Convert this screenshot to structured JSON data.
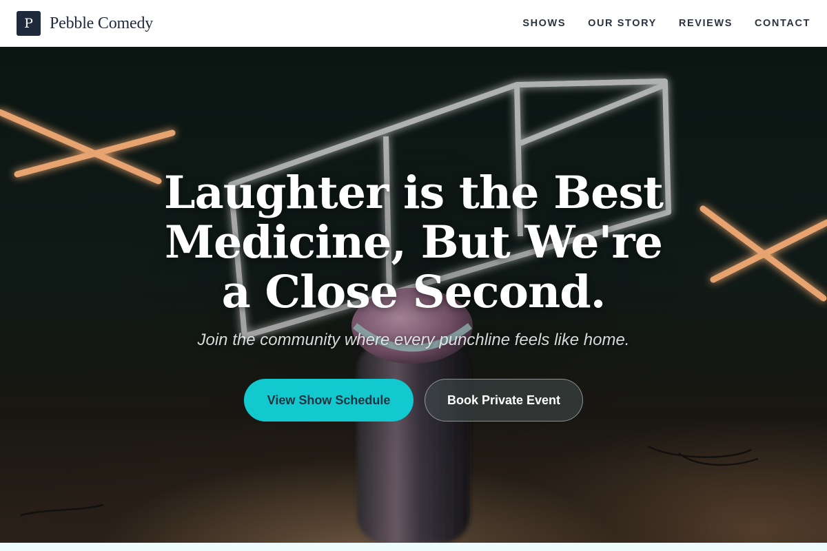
{
  "nav": {
    "logo_letter": "P",
    "brand_name": "Pebble Comedy",
    "links": [
      "SHOWS",
      "OUR STORY",
      "REVIEWS",
      "CONTACT"
    ]
  },
  "hero": {
    "title": "Laughter is the Best Medicine, But We're a Close Second.",
    "subtitle": "Join the community where every punchline feels like home.",
    "primary_button": "View Show Schedule",
    "secondary_button": "Book Private Event"
  },
  "colors": {
    "brand_dark": "#1f2a3c",
    "accent_teal": "#12c9d0",
    "nav_background": "#ffffff"
  }
}
